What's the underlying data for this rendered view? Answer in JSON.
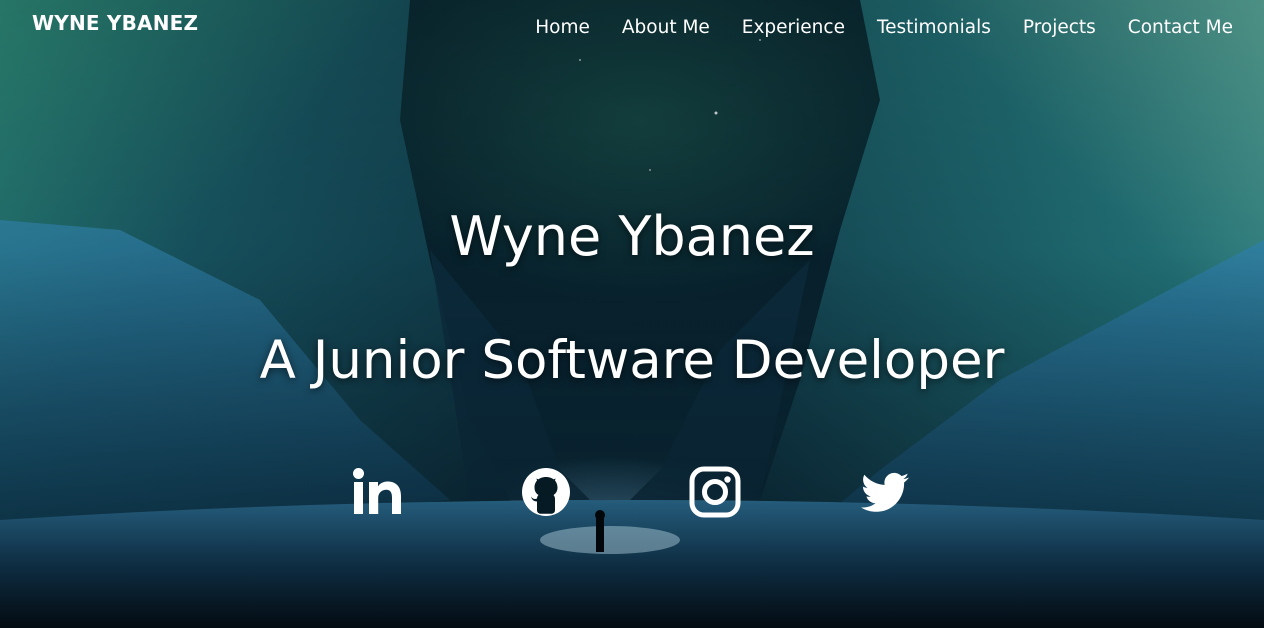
{
  "brand": {
    "label": "WYNE YBANEZ"
  },
  "nav": {
    "items": [
      {
        "label": "Home"
      },
      {
        "label": "About Me"
      },
      {
        "label": "Experience"
      },
      {
        "label": "Testimonials"
      },
      {
        "label": "Projects"
      },
      {
        "label": "Contact Me"
      }
    ]
  },
  "hero": {
    "name": "Wyne Ybanez",
    "role": "A Junior Software Developer"
  },
  "social": {
    "icons": [
      "linkedin-icon",
      "github-icon",
      "instagram-icon",
      "twitter-icon"
    ]
  },
  "colors": {
    "text": "#ffffff",
    "background_dark": "#061a24",
    "background_teal": "#0a2a33",
    "glow": "#78bee6"
  }
}
